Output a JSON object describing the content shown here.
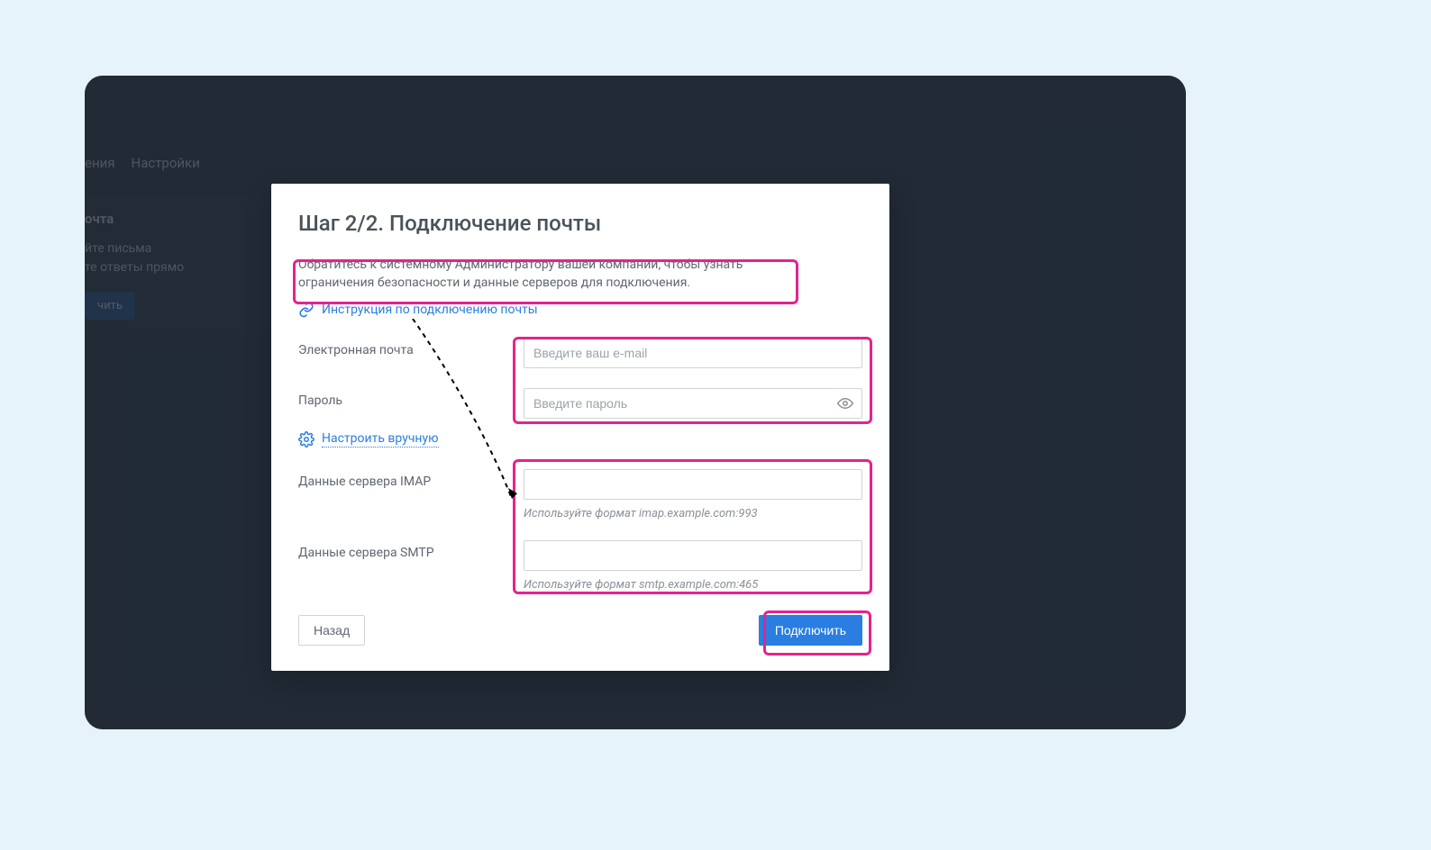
{
  "background": {
    "nav": {
      "item1_suffix": "ения",
      "item2": "Настройки"
    },
    "card": {
      "title_suffix": "очта",
      "line1_suffix": "йте письма",
      "line2_suffix": "те ответы прямо",
      "button_suffix": "чить"
    }
  },
  "modal": {
    "title": "Шаг 2/2. Подключение почты",
    "info_text": "Обратитесь к системному Администратору вашей компании, чтобы узнать ограничения безопасности и данные серверов для подключения.",
    "instruction_link": "Инструкция по подключению почты",
    "labels": {
      "email": "Электронная почта",
      "password": "Пароль",
      "manual": "Настроить вручную",
      "imap": "Данные сервера IMAP",
      "smtp": "Данные сервера SMTP"
    },
    "placeholders": {
      "email": "Введите ваш e-mail",
      "password": "Введите пароль"
    },
    "hints": {
      "imap": "Используйте формат imap.example.com:993",
      "smtp": "Используйте формат smtp.example.com:465"
    },
    "buttons": {
      "back": "Назад",
      "connect": "Подключить"
    }
  },
  "colors": {
    "highlight": "#e4238e",
    "primary": "#2a7de1"
  }
}
